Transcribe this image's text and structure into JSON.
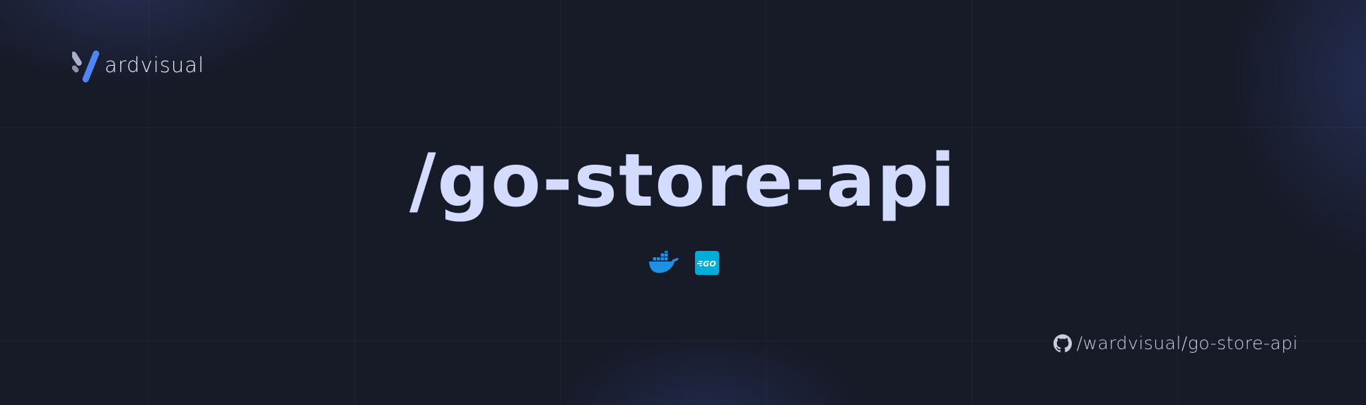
{
  "brand": {
    "name": "ardvisual",
    "logo_icon": "v-slash-logo-icon",
    "accent_color": "#4f86f7"
  },
  "title": "/go-store-api",
  "tech_stack": [
    {
      "icon": "docker-whale-icon",
      "color": "#1d91e6"
    },
    {
      "icon": "go-gopher-badge-icon",
      "label": "GO",
      "color": "#00add8"
    }
  ],
  "repo": {
    "icon": "github-icon",
    "path": "/wardvisual/go-store-api"
  },
  "colors": {
    "background": "#171a27",
    "title": "#d3dcff",
    "text": "#c9cedf"
  }
}
